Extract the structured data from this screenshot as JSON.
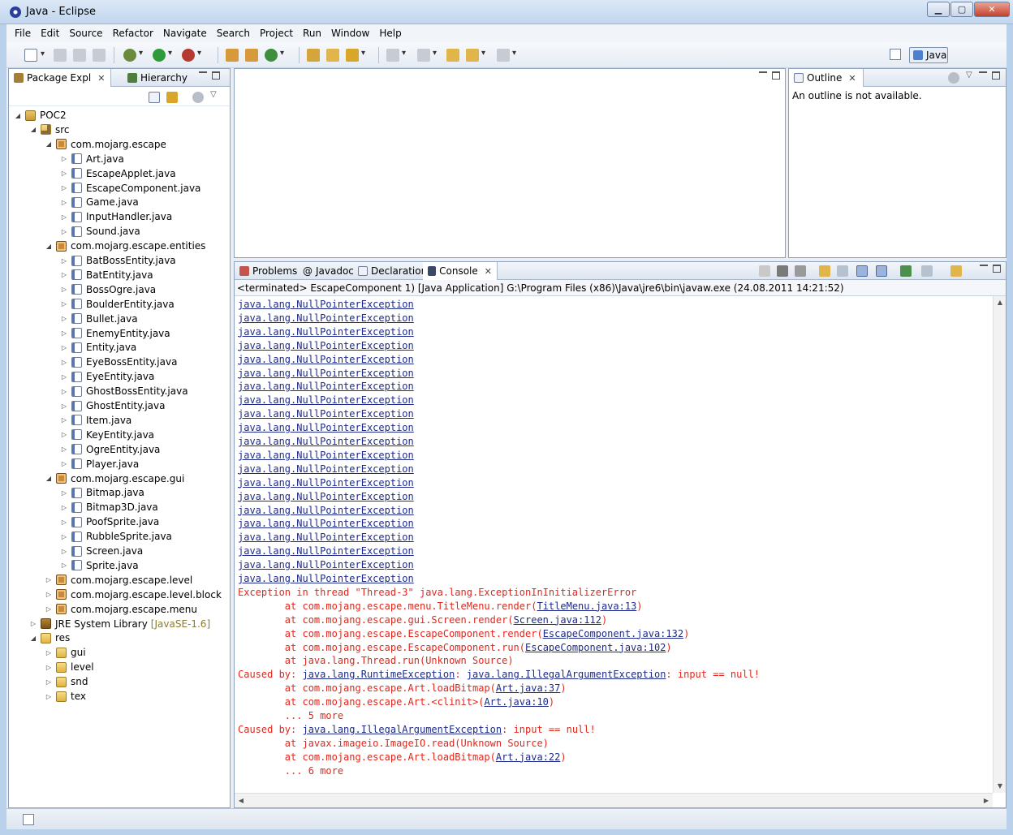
{
  "window": {
    "title": "Java - Eclipse"
  },
  "menu": [
    "File",
    "Edit",
    "Source",
    "Refactor",
    "Navigate",
    "Search",
    "Project",
    "Run",
    "Window",
    "Help"
  ],
  "perspective": {
    "label": "Java"
  },
  "package_explorer": {
    "tab_label": "Package Expl",
    "hierarchy_label": "Hierarchy",
    "tree": [
      {
        "label": "POC2",
        "icon": "project",
        "depth": 0,
        "twisty": "open"
      },
      {
        "label": "src",
        "icon": "src",
        "depth": 1,
        "twisty": "open"
      },
      {
        "label": "com.mojarg.escape",
        "icon": "package",
        "depth": 2,
        "twisty": "open"
      },
      {
        "label": "Art.java",
        "icon": "java",
        "depth": 3,
        "twisty": "closed"
      },
      {
        "label": "EscapeApplet.java",
        "icon": "java",
        "depth": 3,
        "twisty": "closed"
      },
      {
        "label": "EscapeComponent.java",
        "icon": "java",
        "depth": 3,
        "twisty": "closed"
      },
      {
        "label": "Game.java",
        "icon": "java",
        "depth": 3,
        "twisty": "closed"
      },
      {
        "label": "InputHandler.java",
        "icon": "java",
        "depth": 3,
        "twisty": "closed"
      },
      {
        "label": "Sound.java",
        "icon": "java",
        "depth": 3,
        "twisty": "closed"
      },
      {
        "label": "com.mojarg.escape.entities",
        "icon": "package",
        "depth": 2,
        "twisty": "open"
      },
      {
        "label": "BatBossEntity.java",
        "icon": "java",
        "depth": 3,
        "twisty": "closed"
      },
      {
        "label": "BatEntity.java",
        "icon": "java",
        "depth": 3,
        "twisty": "closed"
      },
      {
        "label": "BossOgre.java",
        "icon": "java",
        "depth": 3,
        "twisty": "closed"
      },
      {
        "label": "BoulderEntity.java",
        "icon": "java",
        "depth": 3,
        "twisty": "closed"
      },
      {
        "label": "Bullet.java",
        "icon": "java",
        "depth": 3,
        "twisty": "closed"
      },
      {
        "label": "EnemyEntity.java",
        "icon": "java",
        "depth": 3,
        "twisty": "closed"
      },
      {
        "label": "Entity.java",
        "icon": "java",
        "depth": 3,
        "twisty": "closed"
      },
      {
        "label": "EyeBossEntity.java",
        "icon": "java",
        "depth": 3,
        "twisty": "closed"
      },
      {
        "label": "EyeEntity.java",
        "icon": "java",
        "depth": 3,
        "twisty": "closed"
      },
      {
        "label": "GhostBossEntity.java",
        "icon": "java",
        "depth": 3,
        "twisty": "closed"
      },
      {
        "label": "GhostEntity.java",
        "icon": "java",
        "depth": 3,
        "twisty": "closed"
      },
      {
        "label": "Item.java",
        "icon": "java",
        "depth": 3,
        "twisty": "closed"
      },
      {
        "label": "KeyEntity.java",
        "icon": "java",
        "depth": 3,
        "twisty": "closed"
      },
      {
        "label": "OgreEntity.java",
        "icon": "java",
        "depth": 3,
        "twisty": "closed"
      },
      {
        "label": "Player.java",
        "icon": "java",
        "depth": 3,
        "twisty": "closed"
      },
      {
        "label": "com.mojarg.escape.gui",
        "icon": "package",
        "depth": 2,
        "twisty": "open"
      },
      {
        "label": "Bitmap.java",
        "icon": "java",
        "depth": 3,
        "twisty": "closed"
      },
      {
        "label": "Bitmap3D.java",
        "icon": "java",
        "depth": 3,
        "twisty": "closed"
      },
      {
        "label": "PoofSprite.java",
        "icon": "java",
        "depth": 3,
        "twisty": "closed"
      },
      {
        "label": "RubbleSprite.java",
        "icon": "java",
        "depth": 3,
        "twisty": "closed"
      },
      {
        "label": "Screen.java",
        "icon": "java",
        "depth": 3,
        "twisty": "closed"
      },
      {
        "label": "Sprite.java",
        "icon": "java",
        "depth": 3,
        "twisty": "closed"
      },
      {
        "label": "com.mojarg.escape.level",
        "icon": "package",
        "depth": 2,
        "twisty": "closed"
      },
      {
        "label": "com.mojarg.escape.level.block",
        "icon": "package",
        "depth": 2,
        "twisty": "closed"
      },
      {
        "label": "com.mojarg.escape.menu",
        "icon": "package",
        "depth": 2,
        "twisty": "closed"
      },
      {
        "label": "JRE System Library",
        "extra": "[JavaSE-1.6]",
        "icon": "library",
        "depth": 1,
        "twisty": "closed"
      },
      {
        "label": "res",
        "icon": "folder",
        "depth": 1,
        "twisty": "open"
      },
      {
        "label": "gui",
        "icon": "folder",
        "depth": 2,
        "twisty": "closed"
      },
      {
        "label": "level",
        "icon": "folder",
        "depth": 2,
        "twisty": "closed"
      },
      {
        "label": "snd",
        "icon": "folder",
        "depth": 2,
        "twisty": "closed"
      },
      {
        "label": "tex",
        "icon": "folder",
        "depth": 2,
        "twisty": "closed"
      }
    ]
  },
  "outline": {
    "tab_label": "Outline",
    "message": "An outline is not available."
  },
  "console_tabs": [
    {
      "label": "Problems",
      "icon": "problems-icon"
    },
    {
      "label": "Javadoc",
      "icon": "javadoc-icon"
    },
    {
      "label": "Declaration",
      "icon": "declaration-icon"
    },
    {
      "label": "Console",
      "icon": "console-icon",
      "active": true
    }
  ],
  "console": {
    "status": "<terminated> EscapeComponent 1) [Java Application] G:\\Program Files (x86)\\Java\\jre6\\bin\\javaw.exe (24.08.2011 14:21:52)",
    "lines": [
      [
        {
          "t": "java.lang.NullPointerException",
          "link": true
        }
      ],
      [
        {
          "t": "java.lang.NullPointerException",
          "link": true
        }
      ],
      [
        {
          "t": "java.lang.NullPointerException",
          "link": true
        }
      ],
      [
        {
          "t": "java.lang.NullPointerException",
          "link": true
        }
      ],
      [
        {
          "t": "java.lang.NullPointerException",
          "link": true
        }
      ],
      [
        {
          "t": "java.lang.NullPointerException",
          "link": true
        }
      ],
      [
        {
          "t": "java.lang.NullPointerException",
          "link": true
        }
      ],
      [
        {
          "t": "java.lang.NullPointerException",
          "link": true
        }
      ],
      [
        {
          "t": "java.lang.NullPointerException",
          "link": true
        }
      ],
      [
        {
          "t": "java.lang.NullPointerException",
          "link": true
        }
      ],
      [
        {
          "t": "java.lang.NullPointerException",
          "link": true
        }
      ],
      [
        {
          "t": "java.lang.NullPointerException",
          "link": true
        }
      ],
      [
        {
          "t": "java.lang.NullPointerException",
          "link": true
        }
      ],
      [
        {
          "t": "java.lang.NullPointerException",
          "link": true
        }
      ],
      [
        {
          "t": "java.lang.NullPointerException",
          "link": true
        }
      ],
      [
        {
          "t": "java.lang.NullPointerException",
          "link": true
        }
      ],
      [
        {
          "t": "java.lang.NullPointerException",
          "link": true
        }
      ],
      [
        {
          "t": "java.lang.NullPointerException",
          "link": true
        }
      ],
      [
        {
          "t": "java.lang.NullPointerException",
          "link": true
        }
      ],
      [
        {
          "t": "java.lang.NullPointerException",
          "link": true
        }
      ],
      [
        {
          "t": "java.lang.NullPointerException",
          "link": true
        }
      ],
      [
        {
          "t": "Exception in thread \"Thread-3\" java.lang.ExceptionInInitializerError"
        }
      ],
      [
        {
          "t": "        at com.mojang.escape.menu.TitleMenu.render("
        },
        {
          "t": "TitleMenu.java:13",
          "link": true
        },
        {
          "t": ")"
        }
      ],
      [
        {
          "t": "        at com.mojang.escape.gui.Screen.render("
        },
        {
          "t": "Screen.java:112",
          "link": true
        },
        {
          "t": ")"
        }
      ],
      [
        {
          "t": "        at com.mojang.escape.EscapeComponent.render("
        },
        {
          "t": "EscapeComponent.java:132",
          "link": true
        },
        {
          "t": ")"
        }
      ],
      [
        {
          "t": "        at com.mojang.escape.EscapeComponent.run("
        },
        {
          "t": "EscapeComponent.java:102",
          "link": true
        },
        {
          "t": ")"
        }
      ],
      [
        {
          "t": "        at java.lang.Thread.run(Unknown Source)"
        }
      ],
      [
        {
          "t": "Caused by: "
        },
        {
          "t": "java.lang.RuntimeException",
          "link": true
        },
        {
          "t": ": "
        },
        {
          "t": "java.lang.IllegalArgumentException",
          "link": true
        },
        {
          "t": ": input == null!"
        }
      ],
      [
        {
          "t": "        at com.mojang.escape.Art.loadBitmap("
        },
        {
          "t": "Art.java:37",
          "link": true
        },
        {
          "t": ")"
        }
      ],
      [
        {
          "t": "        at com.mojang.escape.Art.<clinit>("
        },
        {
          "t": "Art.java:10",
          "link": true
        },
        {
          "t": ")"
        }
      ],
      [
        {
          "t": "        ... 5 more"
        }
      ],
      [
        {
          "t": "Caused by: "
        },
        {
          "t": "java.lang.IllegalArgumentException",
          "link": true
        },
        {
          "t": ": input == null!"
        }
      ],
      [
        {
          "t": "        at javax.imageio.ImageIO.read(Unknown Source)"
        }
      ],
      [
        {
          "t": "        at com.mojang.escape.Art.loadBitmap("
        },
        {
          "t": "Art.java:22",
          "link": true
        },
        {
          "t": ")"
        }
      ],
      [
        {
          "t": "        ... 6 more"
        }
      ]
    ]
  },
  "colors": {
    "stderr": "#e3261b",
    "link": "#1e2a8a",
    "chrome": "#b9d1ea"
  }
}
